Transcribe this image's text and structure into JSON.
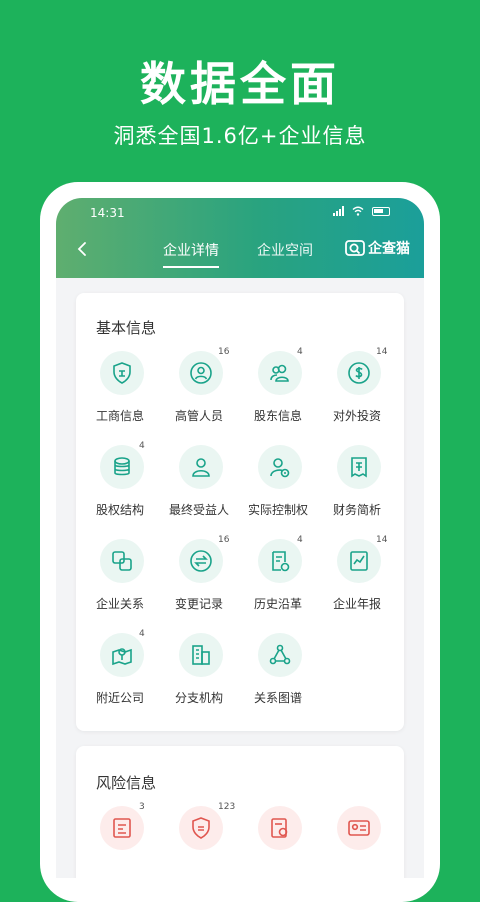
{
  "hero": {
    "title": "数据全面",
    "subtitle": "洞悉全国1.6亿+企业信息"
  },
  "status_bar": {
    "time": "14:31"
  },
  "app_bar": {
    "tabs": [
      {
        "label": "企业详情",
        "active": true
      },
      {
        "label": "企业空间",
        "active": false
      }
    ],
    "brand": "企查猫"
  },
  "basic_info": {
    "title": "基本信息",
    "items": [
      {
        "label": "工商信息",
        "badge": "",
        "icon": "business-license-icon"
      },
      {
        "label": "高管人员",
        "badge": "16",
        "icon": "person-icon"
      },
      {
        "label": "股东信息",
        "badge": "4",
        "icon": "shareholders-icon"
      },
      {
        "label": "对外投资",
        "badge": "14",
        "icon": "dollar-icon"
      },
      {
        "label": "股权结构",
        "badge": "4",
        "icon": "database-icon"
      },
      {
        "label": "最终受益人",
        "badge": "",
        "icon": "beneficiary-icon"
      },
      {
        "label": "实际控制权",
        "badge": "",
        "icon": "controller-icon"
      },
      {
        "label": "财务简析",
        "badge": "",
        "icon": "receipt-icon"
      },
      {
        "label": "企业关系",
        "badge": "",
        "icon": "relation-squares-icon"
      },
      {
        "label": "变更记录",
        "badge": "16",
        "icon": "swap-icon"
      },
      {
        "label": "历史沿革",
        "badge": "4",
        "icon": "history-doc-icon"
      },
      {
        "label": "企业年报",
        "badge": "14",
        "icon": "annual-report-icon"
      },
      {
        "label": "附近公司",
        "badge": "4",
        "icon": "map-pin-icon"
      },
      {
        "label": "分支机构",
        "badge": "",
        "icon": "building-icon"
      },
      {
        "label": "关系图谱",
        "badge": "",
        "icon": "graph-icon"
      }
    ]
  },
  "risk_info": {
    "title": "风险信息",
    "items": [
      {
        "label": "",
        "badge": "3",
        "icon": "risk-doc-icon"
      },
      {
        "label": "",
        "badge": "123",
        "icon": "law-shield-icon"
      },
      {
        "label": "",
        "badge": "",
        "icon": "seal-doc-icon"
      },
      {
        "label": "",
        "badge": "",
        "icon": "id-card-icon"
      }
    ]
  },
  "colors": {
    "background": "#1db25b",
    "icon_green": "#1aa38a",
    "icon_bg": "#eaf6f2",
    "risk_red": "#e0564f",
    "risk_bg": "#fdeceb"
  }
}
